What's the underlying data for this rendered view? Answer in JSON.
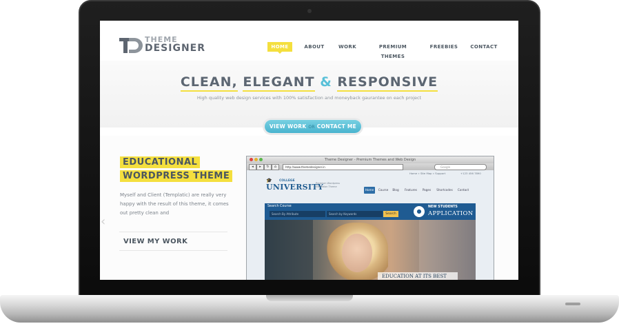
{
  "site": {
    "logo": {
      "line1": "THEME",
      "line2": "DESIGNER"
    },
    "nav": [
      {
        "label": "HOME"
      },
      {
        "label": "ABOUT"
      },
      {
        "label": "WORK"
      },
      {
        "label": "PREMIUM THEMES"
      },
      {
        "label": "FREEBIES"
      },
      {
        "label": "CONTACT"
      }
    ],
    "hero": {
      "word1": "CLEAN,",
      "word2": "ELEGANT",
      "amp": "&",
      "word3": "RESPONSIVE",
      "subtitle": "High quality web design services with 100% satisfaction and moneyback gaurantee on each project"
    },
    "cta": {
      "view_work": "VIEW WORK",
      "or": "OR",
      "contact": "CONTACT ME"
    },
    "project": {
      "title_line1": "EDUCATIONAL",
      "title_line2": "WORDPRESS THEME",
      "description": "Myself and Client (Templatic) are really very happy with the result of this theme, it comes out pretty clean and",
      "view_my_work": "VIEW MY WORK"
    }
  },
  "mockup": {
    "window_title": "Theme Designer - Premium Themes and Web Design",
    "url": "http://www.themedesigner.in",
    "search_placeholder": "Google",
    "top_links": "Home » Site Map » Support",
    "phone": "+123 456 7890",
    "college": "COLLEGE",
    "university": "UNIVERSITY",
    "tagline": "Premium Wordpress Education Theme",
    "nav": [
      "Home",
      "Course",
      "Blog",
      "Features",
      "Pages",
      "Shortcodes",
      "Contact"
    ],
    "search_label": "Search Course",
    "attr_placeholder": "Search By Attribute",
    "keyword_placeholder": "Search by Keywords",
    "search_button": "Search",
    "new_students": "NEW STUDENTS",
    "application": "APPLICATION",
    "caption": "EDUCATION AT ITS BEST"
  },
  "colors": {
    "accent_yellow": "#f4df3e",
    "accent_blue": "#58c0d8",
    "text_dark": "#4b5660",
    "univ_blue": "#1f5b92"
  }
}
